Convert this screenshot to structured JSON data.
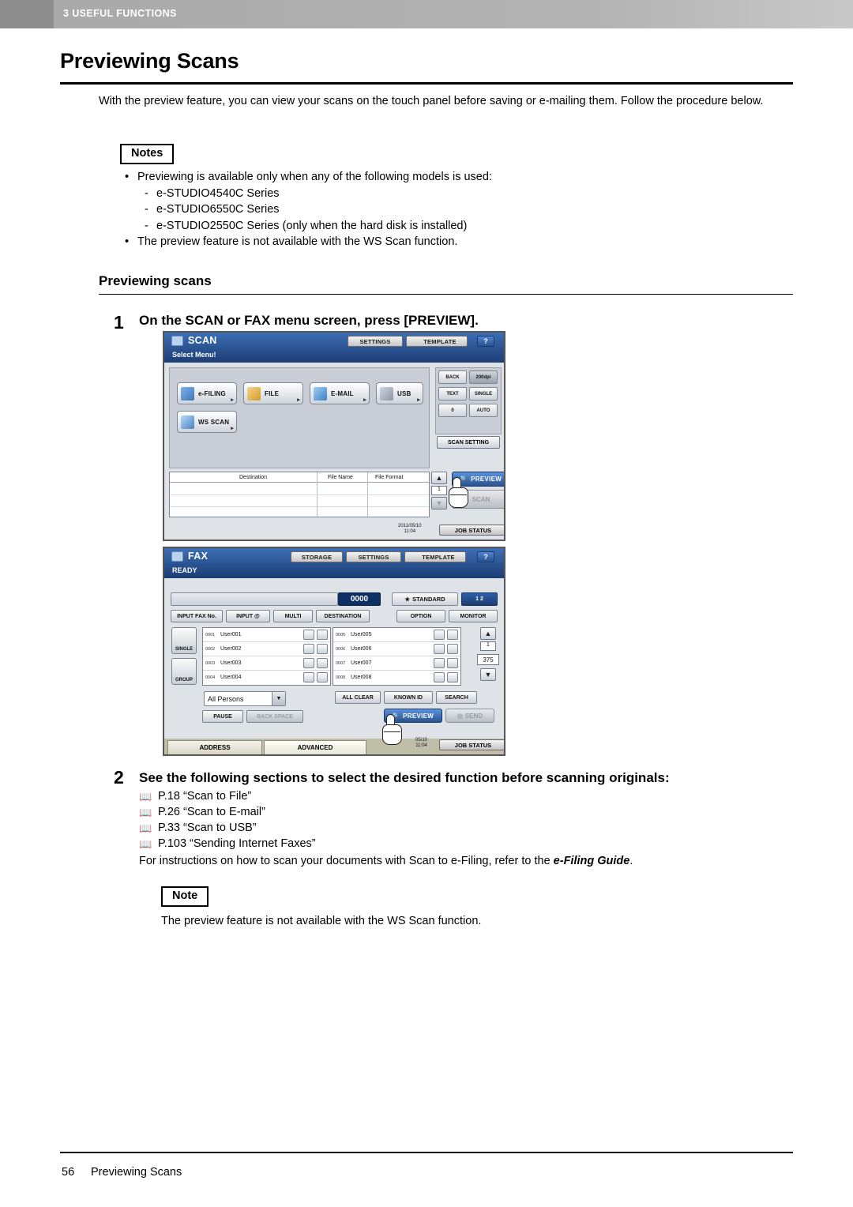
{
  "header": {
    "chapter_label": "3 USEFUL FUNCTIONS"
  },
  "page": {
    "title": "Previewing Scans",
    "intro": "With the preview feature, you can view your scans on the touch panel before saving or e-mailing them. Follow the procedure below.",
    "notes_tag": "Notes",
    "note_tag": "Note",
    "notes": [
      {
        "type": "bullet",
        "text": "Previewing is available only when any of the following models is used:"
      },
      {
        "type": "sub",
        "text": "e-STUDIO4540C Series"
      },
      {
        "type": "sub",
        "text": "e-STUDIO6550C Series"
      },
      {
        "type": "sub",
        "text": "e-STUDIO2550C Series (only when the hard disk is installed)"
      },
      {
        "type": "bullet",
        "text": "The preview feature is not available with the WS Scan function."
      }
    ],
    "subsection": "Previewing scans",
    "steps": [
      {
        "num": "1",
        "text": "On the SCAN or FAX menu screen, press [PREVIEW]."
      },
      {
        "num": "2",
        "text": "See the following sections to select the desired function before scanning originals:"
      }
    ],
    "references": [
      "P.18 “Scan to File”",
      "P.26 “Scan to E-mail”",
      "P.33 “Scan to USB”",
      "P.103 “Sending Internet Faxes”"
    ],
    "efiling_line_pre": "For instructions on how to scan your documents with Scan to e-Filing, refer to the ",
    "efiling_line_em": "e-Filing Guide",
    "efiling_line_post": ".",
    "note_text": "The preview feature is not available with the WS Scan function.",
    "footer": {
      "page_number": "56",
      "title": "Previewing Scans"
    }
  },
  "scan_panel": {
    "title": "SCAN",
    "subtitle": "Select Menu!",
    "top_buttons": [
      {
        "label": "SETTINGS"
      },
      {
        "label": "TEMPLATE"
      }
    ],
    "help_button": "?",
    "menu_buttons": [
      {
        "label": "e-FILING"
      },
      {
        "label": "FILE"
      },
      {
        "label": "E-MAIL"
      },
      {
        "label": "USB"
      },
      {
        "label": "WS SCAN"
      }
    ],
    "right_pad_buttons": [
      {
        "label": "BACK"
      },
      {
        "label": "200dpi"
      },
      {
        "label": "TEXT"
      },
      {
        "label": "SINGLE"
      },
      {
        "label": "0"
      },
      {
        "label": "AUTO"
      }
    ],
    "scan_setting_button": "SCAN SETTING",
    "table_headers": [
      "Destination",
      "File Name",
      "File Format"
    ],
    "page_indicator": "1",
    "preview_button": "PREVIEW",
    "scan_button": "SCAN",
    "job_status_button": "JOB STATUS",
    "clock_date": "2011/05/10",
    "clock_time": "11:04"
  },
  "fax_panel": {
    "title": "FAX",
    "subtitle": "READY",
    "top_buttons": [
      {
        "label": "STORAGE"
      },
      {
        "label": "SETTINGS"
      },
      {
        "label": "TEMPLATE"
      }
    ],
    "help_button": "?",
    "fax_number_value": "0000",
    "quality_button": "STANDARD",
    "line_indicator": "1  2",
    "input_buttons": [
      {
        "label": "INPUT FAX No."
      },
      {
        "label": "INPUT @"
      },
      {
        "label": "MULTI"
      },
      {
        "label": "DESTINATION"
      }
    ],
    "right_buttons": [
      {
        "label": "OPTION"
      },
      {
        "label": "MONITOR"
      }
    ],
    "side_buttons": [
      {
        "label": "SINGLE"
      },
      {
        "label": "GROUP"
      }
    ],
    "users_left": [
      {
        "idx": "0001",
        "name": "User001"
      },
      {
        "idx": "0002",
        "name": "User002"
      },
      {
        "idx": "0003",
        "name": "User003"
      },
      {
        "idx": "0004",
        "name": "User004"
      }
    ],
    "users_right": [
      {
        "idx": "0005",
        "name": "User005"
      },
      {
        "idx": "0006",
        "name": "User006"
      },
      {
        "idx": "0007",
        "name": "User007"
      },
      {
        "idx": "0008",
        "name": "User008"
      }
    ],
    "page_indicator": "1",
    "total_indicator": "375",
    "group_select": "All Persons",
    "list_buttons": [
      {
        "label": "ALL CLEAR"
      },
      {
        "label": "KNOWN ID"
      },
      {
        "label": "SEARCH"
      }
    ],
    "bottom_buttons": [
      {
        "label": "PAUSE"
      },
      {
        "label": "BACK SPACE"
      }
    ],
    "preview_button": "PREVIEW",
    "send_button": "SEND",
    "tabs": [
      {
        "label": "ADDRESS"
      },
      {
        "label": "ADVANCED"
      }
    ],
    "job_status_button": "JOB STATUS",
    "clock_date": "05/10",
    "clock_time": "11:04"
  }
}
